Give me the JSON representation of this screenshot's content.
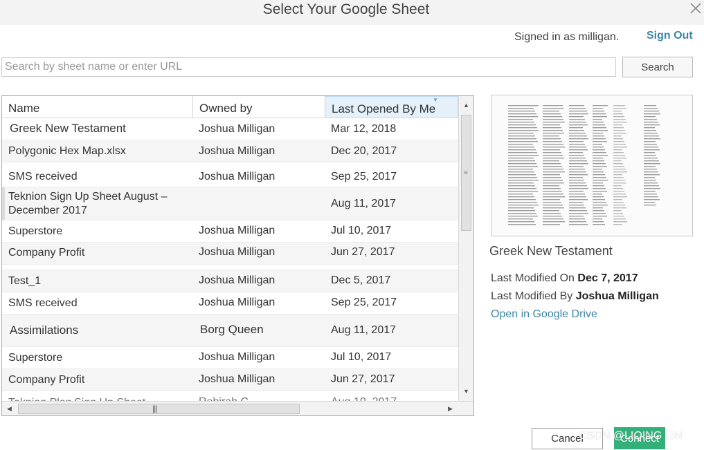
{
  "dialog": {
    "title": "Select Your Google Sheet"
  },
  "account": {
    "signed_in_text": "Signed in as milligan.",
    "sign_out_label": "Sign Out"
  },
  "search": {
    "placeholder": "Search by sheet name or enter URL",
    "value": "",
    "button_label": "Search"
  },
  "table": {
    "columns": [
      "Name",
      "Owned by",
      "Last Opened By Me"
    ],
    "sorted_column": "Last Opened By Me",
    "rows": [
      {
        "name": "Greek New Testament",
        "owner": "Joshua Milligan",
        "date": "Mar 12, 2018"
      },
      {
        "name": "Polygonic Hex Map.xlsx",
        "owner": "Joshua Milligan",
        "date": "Dec 20, 2017"
      },
      {
        "name": "SMS received",
        "owner": "Joshua Milligan",
        "date": "Sep 25, 2017"
      },
      {
        "name": "Teknion Sign Up Sheet August – December 2017",
        "owner": "",
        "date": "Aug 11, 2017"
      },
      {
        "name": "Superstore",
        "owner": "Joshua Milligan",
        "date": "Jul 10, 2017"
      },
      {
        "name": "Company Profit",
        "owner": "Joshua Milligan",
        "date": "Jun 27, 2017"
      },
      {
        "name": "Test_1",
        "owner": "Joshua Milligan",
        "date": "Dec 5, 2017"
      },
      {
        "name": "SMS received",
        "owner": "Joshua Milligan",
        "date": "Sep 25, 2017"
      },
      {
        "name": "Assimilations",
        "owner": "Borg Queen",
        "date": "Aug 11, 2017"
      },
      {
        "name": "Superstore",
        "owner": "Joshua Milligan",
        "date": "Jul 10, 2017"
      },
      {
        "name": "Company Profit",
        "owner": "Joshua Milligan",
        "date": "Jun 27, 2017"
      }
    ]
  },
  "details": {
    "title": "Greek New Testament",
    "modified_on_label": "Last Modified On",
    "modified_on_value": "Dec 7, 2017",
    "modified_by_label": "Last Modified By",
    "modified_by_value": "Joshua Milligan",
    "open_link": "Open in Google Drive"
  },
  "footer": {
    "cancel_label": "Cancel",
    "connect_label": "Connect"
  },
  "watermark": "CSDN @LIQING LIN",
  "icons": {
    "close": "close-icon",
    "scroll_up": "scroll-up-arrow-icon",
    "scroll_down": "scroll-down-arrow-icon",
    "scroll_left": "scroll-left-arrow-icon",
    "scroll_right": "scroll-right-arrow-icon"
  },
  "colors": {
    "accent_link": "#3d86a4",
    "connect_button": "#33b07a",
    "sorted_header": "#e4f0fa"
  }
}
